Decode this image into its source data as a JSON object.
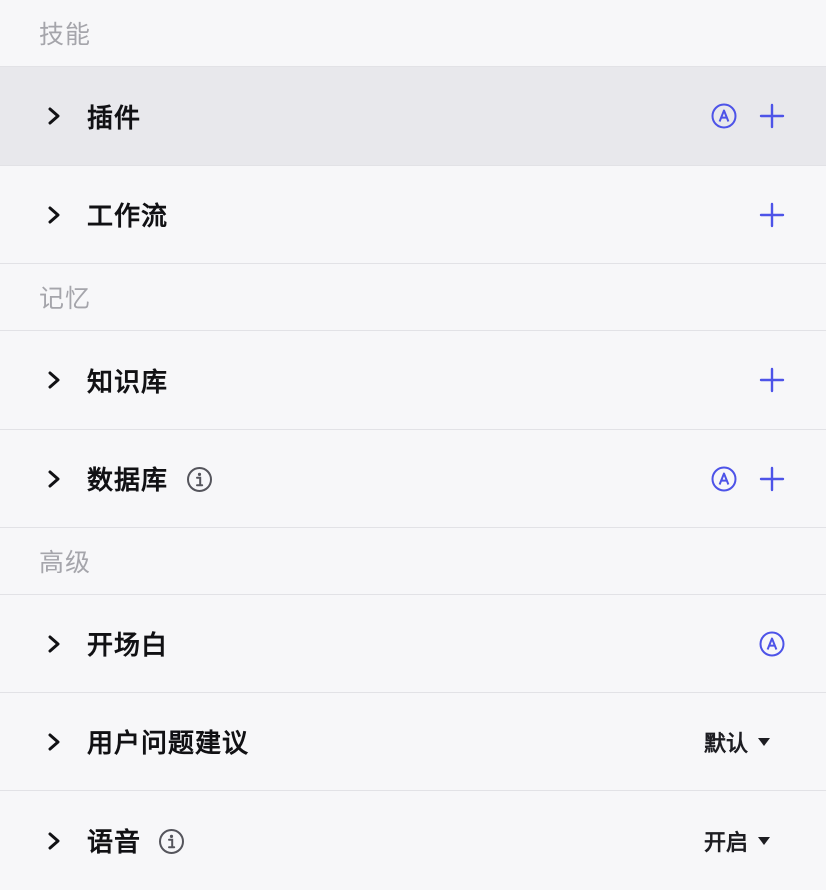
{
  "accent_color": "#4d53e8",
  "sections": [
    {
      "title": "技能",
      "rows": [
        {
          "label": "插件",
          "active": true,
          "info": false,
          "auto": true,
          "add": true
        },
        {
          "label": "工作流",
          "active": false,
          "info": false,
          "auto": false,
          "add": true
        }
      ]
    },
    {
      "title": "记忆",
      "rows": [
        {
          "label": "知识库",
          "active": false,
          "info": false,
          "auto": false,
          "add": true
        },
        {
          "label": "数据库",
          "active": false,
          "info": true,
          "auto": true,
          "add": true
        }
      ]
    },
    {
      "title": "高级",
      "rows": [
        {
          "label": "开场白",
          "active": false,
          "info": false,
          "auto": true,
          "add": false
        },
        {
          "label": "用户问题建议",
          "active": false,
          "info": false,
          "auto": false,
          "add": false,
          "dropdown": "默认"
        },
        {
          "label": "语音",
          "active": false,
          "info": true,
          "auto": false,
          "add": false,
          "dropdown": "开启"
        }
      ]
    }
  ],
  "icons": {
    "expand": "chevron-right-icon",
    "info": "info-circle-icon",
    "auto": "auto-a-circle-icon",
    "add": "plus-icon",
    "dropdown": "caret-down-icon"
  }
}
